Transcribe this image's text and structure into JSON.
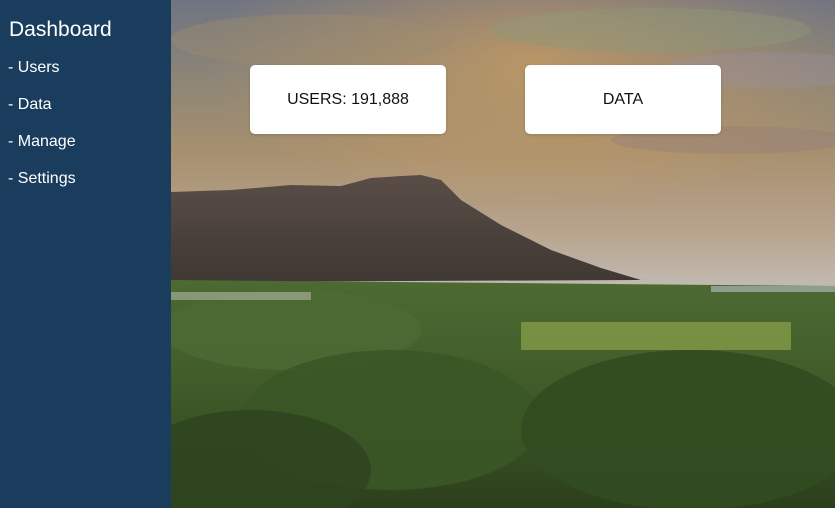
{
  "sidebar": {
    "title": "Dashboard",
    "items": [
      {
        "label": "- Users"
      },
      {
        "label": "- Data"
      },
      {
        "label": "- Manage"
      },
      {
        "label": "- Settings"
      }
    ]
  },
  "cards": {
    "users": {
      "label": "USERS: 191,888"
    },
    "data": {
      "label": "DATA"
    }
  },
  "colors": {
    "sidebar_bg": "#1b3d5d",
    "card_bg": "#ffffff",
    "text_light": "#ffffff"
  }
}
